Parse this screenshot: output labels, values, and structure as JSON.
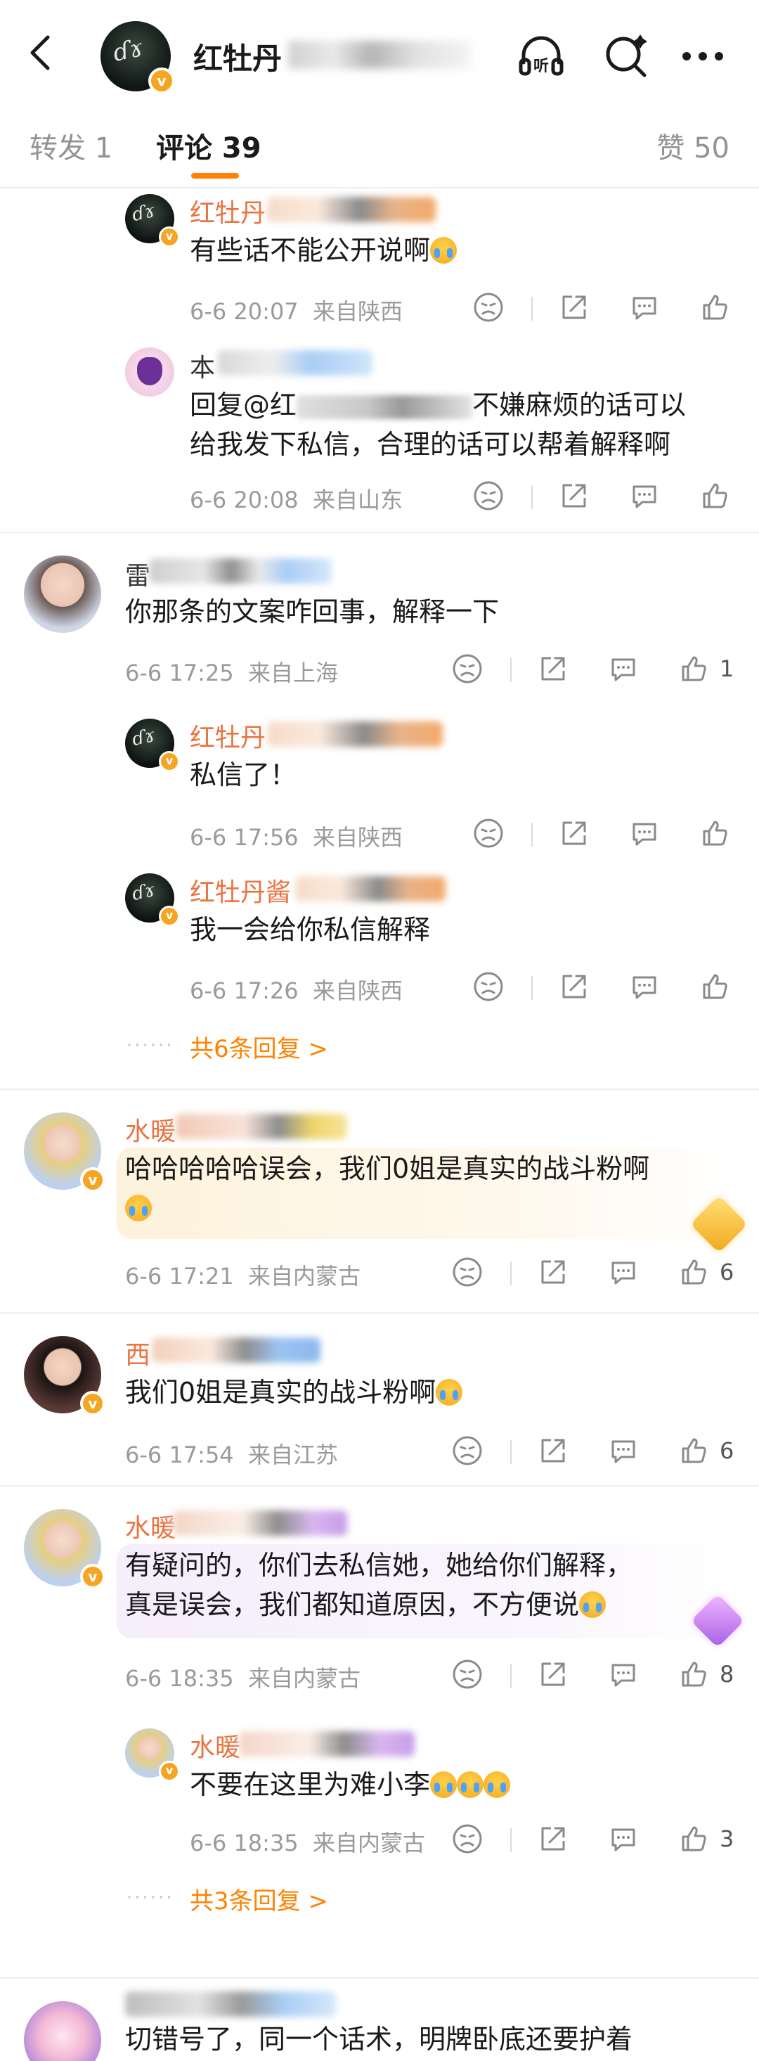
{
  "header": {
    "user_name": "红牡丹",
    "user_name_suffix": "_",
    "listen_label": "听"
  },
  "tabs": {
    "repost": "转发 1",
    "comment": "评论 39",
    "like": "赞 50"
  },
  "colors": {
    "accent": "#ff8200",
    "name": "#eb7340",
    "meta": "#9a9a9a"
  },
  "comments": [
    {
      "name": "红牡丹",
      "text": "有些话不能公开说啊",
      "time": "6-6 20:07",
      "location": "来自陕西",
      "likes": ""
    },
    {
      "name": "本",
      "text_line1_a": "回复@红",
      "text_line1_b": "不嫌麻烦的话可以",
      "text_line2": "给我发下私信，合理的话可以帮着解释啊",
      "time": "6-6 20:08",
      "location": "来自山东",
      "likes": ""
    },
    {
      "name": "雷",
      "text": "你那条的文案咋回事，解释一下",
      "time": "6-6 17:25",
      "location": "来自上海",
      "likes": "1",
      "replies": [
        {
          "name": "红牡丹",
          "text": "私信了！",
          "time": "6-6 17:56",
          "location": "来自陕西"
        },
        {
          "name": "红牡丹酱",
          "text": "我一会给你私信解释",
          "time": "6-6 17:26",
          "location": "来自陕西"
        }
      ],
      "more_replies": "共6条回复 >"
    },
    {
      "name": "水暖",
      "text_line1": "哈哈哈哈哈误会，我们0姐是真实的战斗粉啊",
      "time": "6-6 17:21",
      "location": "来自内蒙古",
      "likes": "6"
    },
    {
      "name": "西",
      "text": "我们0姐是真实的战斗粉啊",
      "time": "6-6 17:54",
      "location": "来自江苏",
      "likes": "6"
    },
    {
      "name": "水暖",
      "text_line1": "有疑问的，你们去私信她，她给你们解释，",
      "text_line2": "真是误会，我们都知道原因，不方便说",
      "time": "6-6 18:35",
      "location": "来自内蒙古",
      "likes": "8",
      "replies": [
        {
          "name": "水暖",
          "text": "不要在这里为难小李",
          "time": "6-6 18:35",
          "location": "来自内蒙古",
          "likes": "3"
        }
      ],
      "more_replies": "共3条回复 >"
    },
    {
      "name": "",
      "text": "切错号了，同一个话术，明牌卧底还要护着"
    }
  ],
  "dots": "······"
}
